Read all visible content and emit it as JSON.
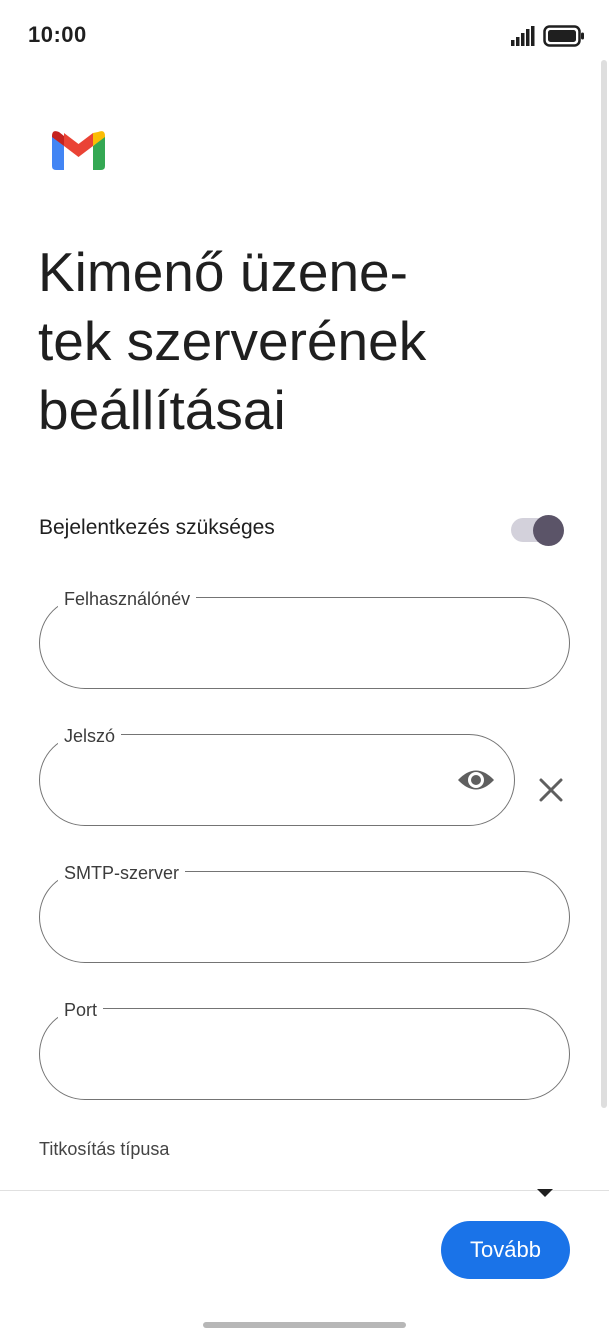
{
  "status_bar": {
    "time": "10:00",
    "signal_icon": "signal-bars-icon",
    "battery_icon": "battery-full-icon"
  },
  "app": {
    "logo_icon": "gmail-logo-icon",
    "title_line1": "Kimenő üzene-",
    "title_line2": "tek szerverének",
    "title_line3": "beállításai"
  },
  "toggle": {
    "label": "Bejelentkezés szükséges",
    "state": "on"
  },
  "fields": {
    "username_label": "Felhasználónév",
    "username_value": "",
    "password_label": "Jelszó",
    "password_value": "",
    "smtp_label": "SMTP-szerver",
    "smtp_value": "",
    "port_label": "Port",
    "port_value": ""
  },
  "encryption": {
    "label": "Titkosítás típusa"
  },
  "actions": {
    "next_label": "Tovább"
  },
  "colors": {
    "primary": "#1a73e8",
    "toggle_knob": "#5b5468",
    "toggle_track": "#d3d1db"
  }
}
